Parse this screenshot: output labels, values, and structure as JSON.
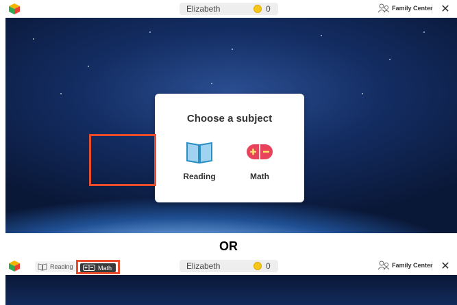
{
  "header": {
    "user_name": "Elizabeth",
    "coin_count": "0",
    "family_center_label": "Family Center",
    "close_label": "✕"
  },
  "dialog": {
    "title": "Choose a subject",
    "subjects": [
      {
        "label": "Reading"
      },
      {
        "label": "Math"
      }
    ]
  },
  "separator": "OR",
  "alt_header": {
    "tabs": [
      {
        "label": "Reading"
      },
      {
        "label": "Math"
      }
    ],
    "user_name": "Elizabeth",
    "coin_count": "0",
    "family_center_label": "Family Center",
    "close_label": "✕"
  },
  "colors": {
    "highlight": "#ea4b2a",
    "coin": "#f5c518",
    "math_icon": "#e8435a",
    "reading_icon": "#2b8fc4"
  }
}
